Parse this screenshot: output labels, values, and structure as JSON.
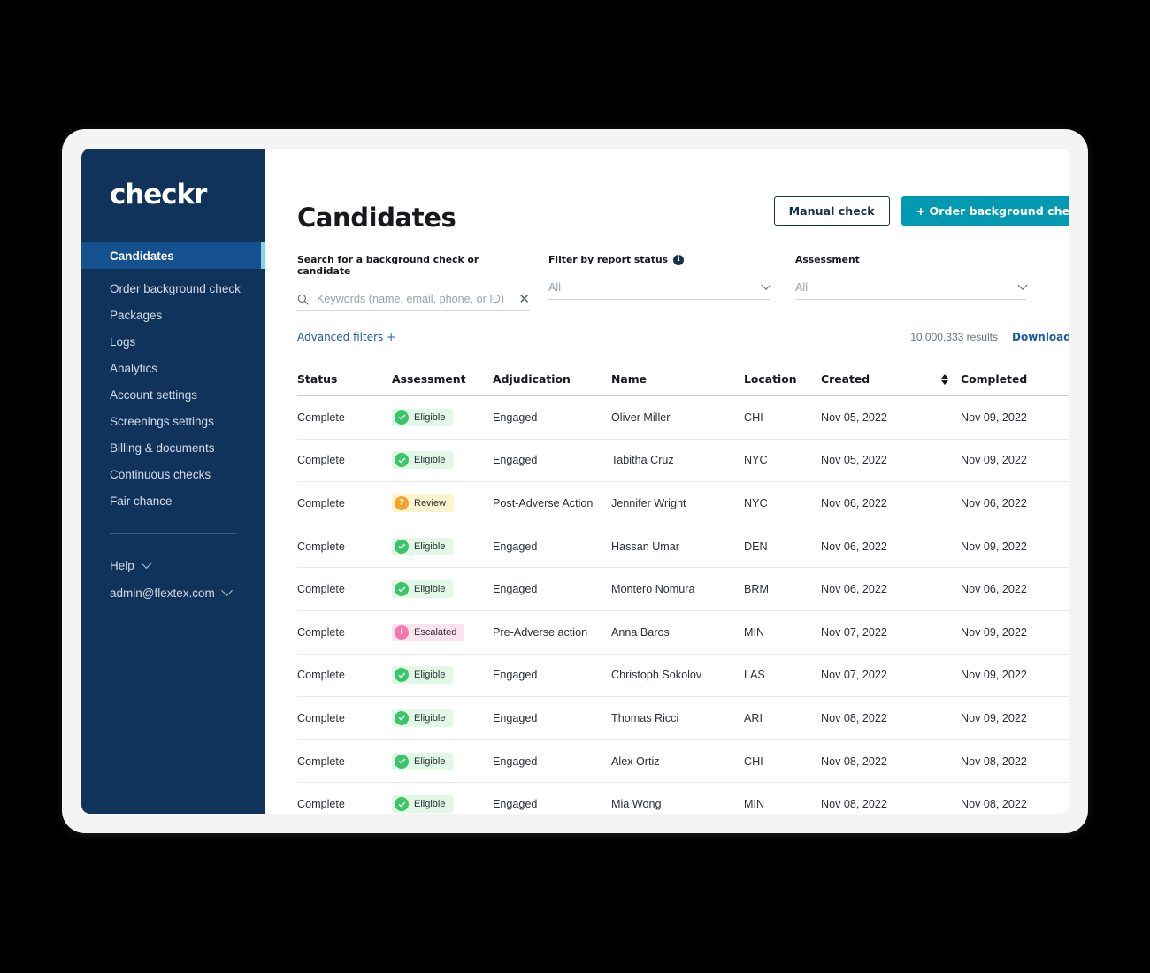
{
  "brand": {
    "logo_text": "checkr",
    "sidebar_bg": "#10335c",
    "active_bg": "#15518f",
    "active_accent": "#7fd4e8",
    "primary_button": "#039ab1",
    "link_color": "#1c5ca8"
  },
  "sidebar": {
    "items": [
      {
        "label": "Candidates",
        "active": true
      },
      {
        "label": "Order background check",
        "active": false
      },
      {
        "label": "Packages",
        "active": false
      },
      {
        "label": "Logs",
        "active": false
      },
      {
        "label": "Analytics",
        "active": false
      },
      {
        "label": "Account settings",
        "active": false
      },
      {
        "label": "Screenings settings",
        "active": false
      },
      {
        "label": "Billing & documents",
        "active": false
      },
      {
        "label": "Continuous checks",
        "active": false
      },
      {
        "label": "Fair chance",
        "active": false
      }
    ],
    "bottom": [
      {
        "label": "Help",
        "chevron": "chevron-down-icon"
      },
      {
        "label": "admin@flextex.com",
        "chevron": "chevron-down-icon"
      }
    ]
  },
  "header": {
    "title": "Candidates",
    "manual_check_label": "Manual check",
    "order_check_label": "+ Order background check"
  },
  "filters": {
    "search": {
      "label": "Search for a background check or candidate",
      "placeholder": "Keywords (name, email, phone, or ID)",
      "value": "",
      "icon": "search-icon",
      "clear_icon": "close-icon"
    },
    "report_status": {
      "label": "Filter by report status",
      "info_icon": "info-icon",
      "value": "All",
      "chevron": "chevron-down-icon"
    },
    "assessment": {
      "label": "Assessment",
      "value": "All",
      "chevron": "chevron-down-icon"
    },
    "advanced_filters_label": "Advanced filters +",
    "results_count": "10,000,333 results",
    "download_csv_label": "Download CSV"
  },
  "table": {
    "columns": [
      "Status",
      "Assessment",
      "Adjudication",
      "Name",
      "Location",
      "Created",
      "Completed"
    ],
    "sortable": [
      "Created",
      "Completed"
    ],
    "rows": [
      {
        "status": "Complete",
        "assessment": "Eligible",
        "assessment_type": "eligible",
        "adjudication": "Engaged",
        "name": "Oliver Miller",
        "location": "CHI",
        "created": "Nov 05, 2022",
        "completed": "Nov 09, 2022"
      },
      {
        "status": "Complete",
        "assessment": "Eligible",
        "assessment_type": "eligible",
        "adjudication": "Engaged",
        "name": "Tabitha Cruz",
        "location": "NYC",
        "created": "Nov 05, 2022",
        "completed": "Nov 09, 2022"
      },
      {
        "status": "Complete",
        "assessment": "Review",
        "assessment_type": "review",
        "adjudication": "Post-Adverse Action",
        "name": "Jennifer Wright",
        "location": "NYC",
        "created": "Nov 06, 2022",
        "completed": "Nov 06, 2022"
      },
      {
        "status": "Complete",
        "assessment": "Eligible",
        "assessment_type": "eligible",
        "adjudication": "Engaged",
        "name": "Hassan Umar",
        "location": "DEN",
        "created": "Nov 06, 2022",
        "completed": "Nov 09, 2022"
      },
      {
        "status": "Complete",
        "assessment": "Eligible",
        "assessment_type": "eligible",
        "adjudication": "Engaged",
        "name": "Montero Nomura",
        "location": "BRM",
        "created": "Nov 06, 2022",
        "completed": "Nov 06, 2022"
      },
      {
        "status": "Complete",
        "assessment": "Escalated",
        "assessment_type": "escalated",
        "adjudication": "Pre-Adverse action",
        "name": "Anna Baros",
        "location": "MIN",
        "created": "Nov 07, 2022",
        "completed": "Nov 09, 2022"
      },
      {
        "status": "Complete",
        "assessment": "Eligible",
        "assessment_type": "eligible",
        "adjudication": "Engaged",
        "name": "Christoph Sokolov",
        "location": "LAS",
        "created": "Nov 07, 2022",
        "completed": "Nov 09, 2022"
      },
      {
        "status": "Complete",
        "assessment": "Eligible",
        "assessment_type": "eligible",
        "adjudication": "Engaged",
        "name": "Thomas Ricci",
        "location": "ARI",
        "created": "Nov 08, 2022",
        "completed": "Nov 09, 2022"
      },
      {
        "status": "Complete",
        "assessment": "Eligible",
        "assessment_type": "eligible",
        "adjudication": "Engaged",
        "name": "Alex Ortiz",
        "location": "CHI",
        "created": "Nov 08, 2022",
        "completed": "Nov 08, 2022"
      },
      {
        "status": "Complete",
        "assessment": "Eligible",
        "assessment_type": "eligible",
        "adjudication": "Engaged",
        "name": "Mia Wong",
        "location": "MIN",
        "created": "Nov 08, 2022",
        "completed": "Nov 08, 2022"
      }
    ]
  }
}
